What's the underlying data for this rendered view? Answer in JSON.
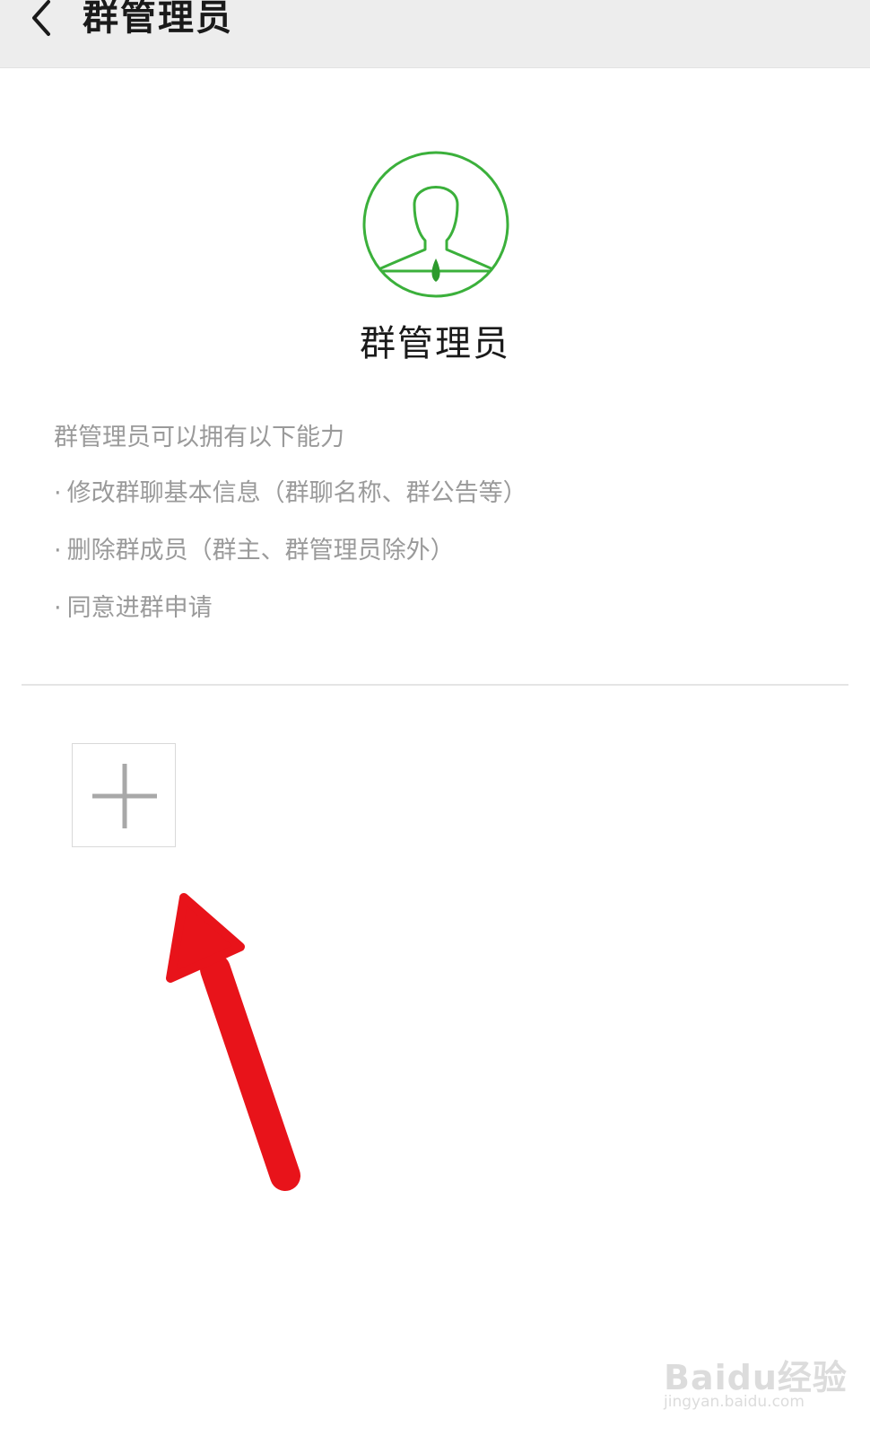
{
  "topbar": {
    "title": "群管理员",
    "back_icon": "chevron-left-icon"
  },
  "header": {
    "avatar_icon": "admin-avatar-icon",
    "title": "群管理员",
    "accent_color": "#3bb03b"
  },
  "description": {
    "intro": "群管理员可以拥有以下能力",
    "bullet": "·",
    "capabilities": [
      "修改群聊基本信息（群聊名称、群公告等）",
      "删除群成员（群主、群管理员除外）",
      "同意进群申请"
    ]
  },
  "add_button": {
    "icon": "plus-icon"
  },
  "annotation": {
    "arrow_color": "#e8131a"
  },
  "watermark": {
    "main": "Baidu经验",
    "sub": "jingyan.baidu.com"
  }
}
